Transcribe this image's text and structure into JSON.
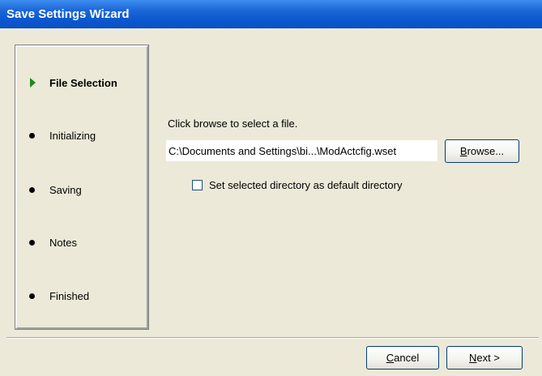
{
  "window": {
    "title": "Save Settings Wizard"
  },
  "steps": [
    {
      "label": "File Selection",
      "state": "current",
      "marker": "green-arrow"
    },
    {
      "label": "Initializing",
      "state": "pending",
      "marker": "bullet"
    },
    {
      "label": "Saving",
      "state": "pending",
      "marker": "bullet"
    },
    {
      "label": "Notes",
      "state": "pending",
      "marker": "bullet"
    },
    {
      "label": "Finished",
      "state": "pending",
      "marker": "bullet"
    }
  ],
  "main": {
    "prompt": "Click browse to select a file.",
    "file_path": "C:\\Documents  and  Settings\\bi...\\ModActcfig.wset",
    "browse_button": {
      "mnemonic": "B",
      "rest": "rowse..."
    },
    "default_dir_checkbox": {
      "label": "Set selected directory as default directory",
      "checked": false
    }
  },
  "footer": {
    "cancel_button": {
      "mnemonic": "C",
      "rest": "ancel"
    },
    "next_button": {
      "mnemonic": "N",
      "rest": "ext >"
    }
  },
  "colors": {
    "title_bar": "#0a58d0",
    "dialog_bg": "#ece9d8",
    "current_step_arrow": "#1e8b1e"
  }
}
